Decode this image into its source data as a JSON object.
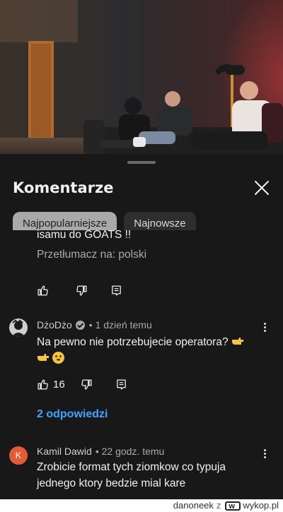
{
  "sheet": {
    "title": "Komentarze",
    "close_icon": "close-icon",
    "chips": [
      "Najpopularniejsze",
      "Najnowsze"
    ]
  },
  "comments": {
    "partial": {
      "text_tail": "isamu do GOATS !!",
      "translate": "Przetłumacz na: polski"
    },
    "dzo": {
      "author": "DżoDżo",
      "time": "• 1 dzień temu",
      "text": "Na pewno nie potrzebujecie operatora?",
      "likes": "16",
      "replies": "2 odpowiedzi"
    },
    "kamil": {
      "avatar_letter": "K",
      "author": "Kamil Dawid",
      "time": "• 22 godz. temu",
      "text_line1": "Zrobicie format tych ziomkow co typuja",
      "text_line2": "jednego ktory bedzie mial kare"
    }
  },
  "watermark": {
    "user": "danoneek",
    "sep": "z",
    "site": "wykop.pl"
  },
  "colors": {
    "background": "#0f0f0f",
    "sheet": "#181818",
    "link": "#3ea6ff",
    "avatar_k": "#e35b35"
  }
}
